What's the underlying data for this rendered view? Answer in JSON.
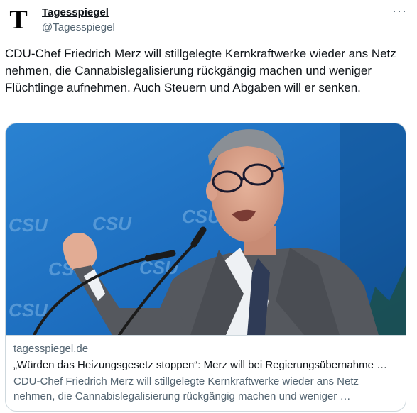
{
  "author": {
    "avatar_letter": "T",
    "name": "Tagesspiegel",
    "handle": "@Tagesspiegel"
  },
  "more_glyph": "···",
  "tweet": {
    "text": "CDU-Chef Friedrich Merz will stillgelegte Kernkraftwerke wieder ans Netz nehmen, die Cannabislegalisierung rückgängig machen und weniger Flüchtlinge aufnehmen. Auch Steuern und Abgaben will er senken."
  },
  "card": {
    "backdrop_logo_text": "CSU",
    "domain": "tagesspiegel.de",
    "title": "„Würden das Heizungsgesetz stoppen“: Merz will bei Regierungsübernahme …",
    "description": "CDU-Chef Friedrich Merz will stillgelegte Kernkraftwerke wieder ans Netz nehmen, die Cannabislegalisierung rückgängig machen und weniger …"
  },
  "colors": {
    "backdrop_blue": "#1f74c4",
    "secondary_text": "#536471",
    "border": "#cfd9de"
  }
}
